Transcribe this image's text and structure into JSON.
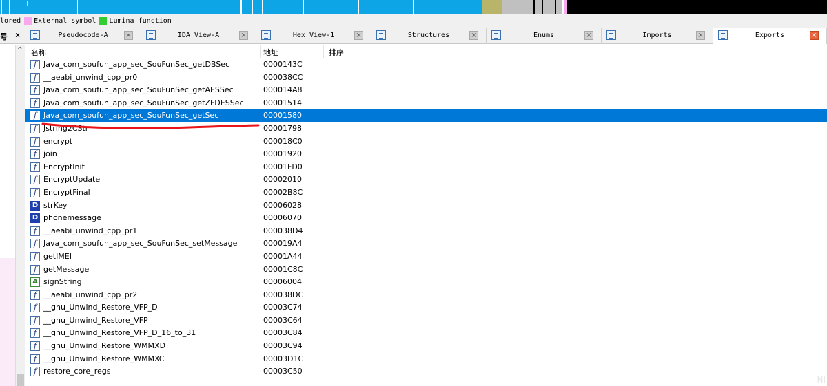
{
  "legend": [
    {
      "color": "#ffffff",
      "label": "lored"
    },
    {
      "color": "#f7a8ee",
      "label": "External symbol"
    },
    {
      "color": "#33cc33",
      "label": "Lumina function"
    }
  ],
  "left_tab": {
    "label": "号",
    "close": "×"
  },
  "tabs": [
    {
      "label": "Pseudocode-A",
      "icon": "pseudocode-icon"
    },
    {
      "label": "IDA View-A",
      "icon": "ida-view-icon"
    },
    {
      "label": "Hex View-1",
      "icon": "hex-view-icon"
    },
    {
      "label": "Structures",
      "icon": "structures-icon"
    },
    {
      "label": "Enums",
      "icon": "enums-icon"
    },
    {
      "label": "Imports",
      "icon": "imports-icon"
    },
    {
      "label": "Exports",
      "icon": "exports-icon"
    }
  ],
  "close_glyph": "×",
  "left_scroll": {
    "arrow": "^"
  },
  "columns": {
    "name": "名称",
    "address": "地址",
    "ordinal": "排序"
  },
  "rows": [
    {
      "icon": "f",
      "name": "Java_com_soufun_app_sec_SouFunSec_getDBSec",
      "address": "0000143C"
    },
    {
      "icon": "f",
      "name": "__aeabi_unwind_cpp_pr0",
      "address": "000038CC"
    },
    {
      "icon": "f",
      "name": "Java_com_soufun_app_sec_SouFunSec_getAESSec",
      "address": "000014A8"
    },
    {
      "icon": "f",
      "name": "Java_com_soufun_app_sec_SouFunSec_getZFDESSec",
      "address": "00001514"
    },
    {
      "icon": "f",
      "name": "Java_com_soufun_app_sec_SouFunSec_getSec",
      "address": "00001580",
      "selected": true
    },
    {
      "icon": "f",
      "name": "Jstring2CStr",
      "address": "00001798"
    },
    {
      "icon": "f",
      "name": "encrypt",
      "address": "000018C0"
    },
    {
      "icon": "f",
      "name": "join",
      "address": "00001920"
    },
    {
      "icon": "f",
      "name": "EncryptInit",
      "address": "00001FD0"
    },
    {
      "icon": "f",
      "name": "EncryptUpdate",
      "address": "00002010"
    },
    {
      "icon": "f",
      "name": "EncryptFinal",
      "address": "00002B8C"
    },
    {
      "icon": "D",
      "name": "strKey",
      "address": "00006028"
    },
    {
      "icon": "D",
      "name": "phonemessage",
      "address": "00006070"
    },
    {
      "icon": "f",
      "name": "__aeabi_unwind_cpp_pr1",
      "address": "000038D4"
    },
    {
      "icon": "f",
      "name": "Java_com_soufun_app_sec_SouFunSec_setMessage",
      "address": "000019A4"
    },
    {
      "icon": "f",
      "name": "getIMEI",
      "address": "00001A44"
    },
    {
      "icon": "f",
      "name": "getMessage",
      "address": "00001C8C"
    },
    {
      "icon": "A",
      "name": "signString",
      "address": "00006004"
    },
    {
      "icon": "f",
      "name": "__aeabi_unwind_cpp_pr2",
      "address": "000038DC"
    },
    {
      "icon": "f",
      "name": "__gnu_Unwind_Restore_VFP_D",
      "address": "00003C74"
    },
    {
      "icon": "f",
      "name": "__gnu_Unwind_Restore_VFP",
      "address": "00003C64"
    },
    {
      "icon": "f",
      "name": "__gnu_Unwind_Restore_VFP_D_16_to_31",
      "address": "00003C84"
    },
    {
      "icon": "f",
      "name": "__gnu_Unwind_Restore_WMMXD",
      "address": "00003C94"
    },
    {
      "icon": "f",
      "name": "__gnu_Unwind_Restore_WMMXC",
      "address": "00003D1C"
    },
    {
      "icon": "f",
      "name": "restore_core_regs",
      "address": "00003C50"
    }
  ],
  "colors": {
    "selection": "#0078d7",
    "nav_code": "#0ea5e6",
    "nav_data": "#b8b46a",
    "nav_unexplored": "#c0c0c0",
    "nav_external": "#f7a8ee",
    "nav_end": "#000000",
    "annotation": "#e8141a"
  },
  "watermark": "NI"
}
